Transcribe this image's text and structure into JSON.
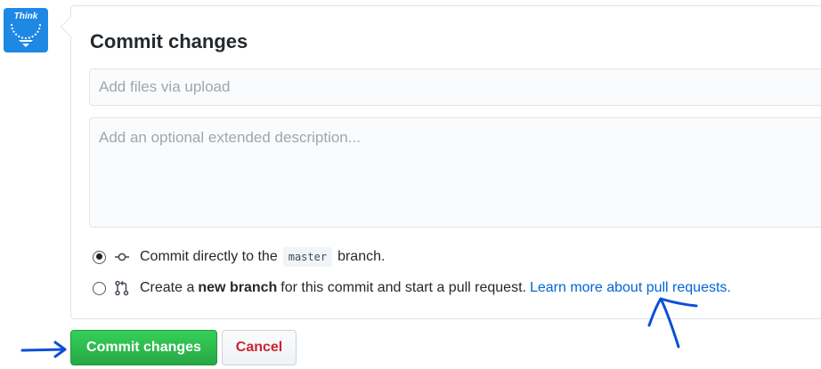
{
  "avatar": {
    "logo_text": "Think",
    "icon": "think-logo"
  },
  "commit_form": {
    "title": "Commit changes",
    "summary_placeholder": "Add files via upload",
    "summary_value": "",
    "description_placeholder": "Add an optional extended description...",
    "description_value": ""
  },
  "options": {
    "direct": {
      "selected": true,
      "icon": "git-commit-icon",
      "text_before": "Commit directly to the",
      "branch": "master",
      "text_after": "branch."
    },
    "new_branch": {
      "selected": false,
      "icon": "git-pull-request-icon",
      "text_before": "Create a",
      "bold": "new branch",
      "text_after": "for this commit and start a pull request.",
      "link": "Learn more about pull requests."
    }
  },
  "buttons": {
    "commit": "Commit changes",
    "cancel": "Cancel"
  },
  "colors": {
    "commit_button": "#28a745",
    "cancel_text": "#cb2431",
    "link": "#0366d6",
    "annotation": "#0b4fd9"
  }
}
